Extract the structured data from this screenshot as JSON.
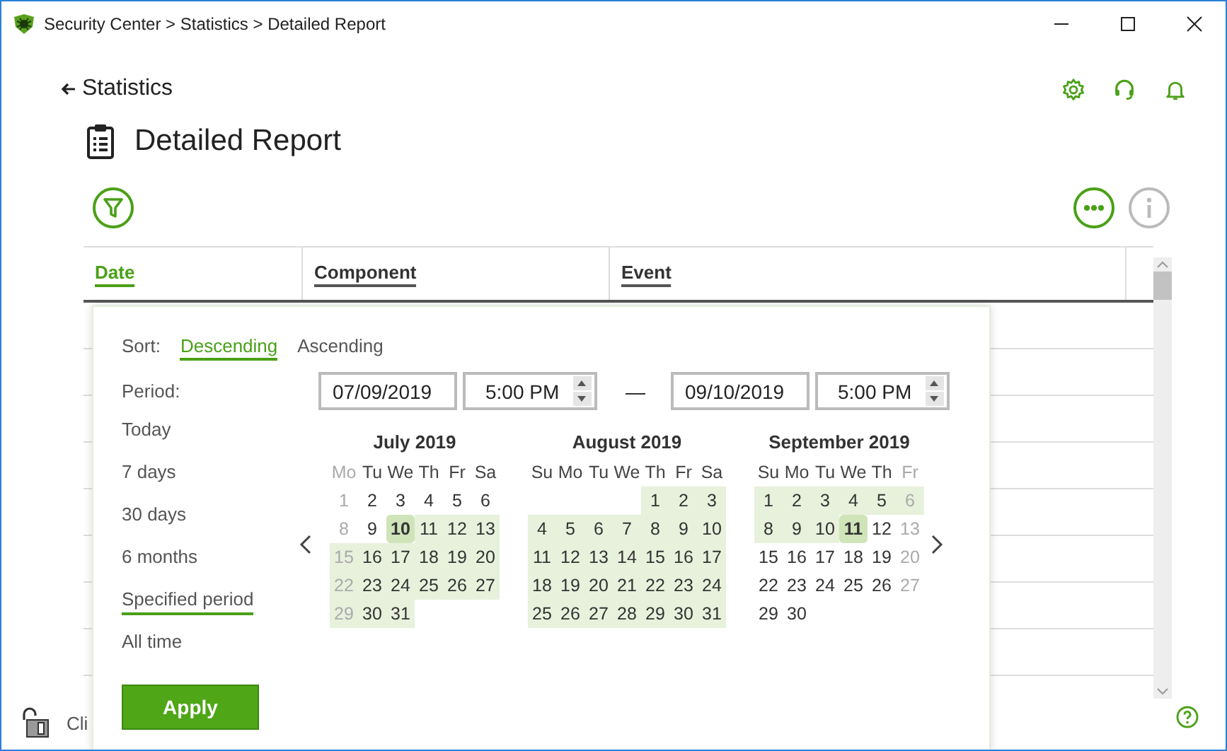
{
  "window": {
    "title": "Security Center > Statistics > Detailed Report"
  },
  "back_link": "Statistics",
  "page_title": "Detailed Report",
  "table": {
    "columns": [
      {
        "label": "Date",
        "selected": true
      },
      {
        "label": "Component",
        "selected": false
      },
      {
        "label": "Event",
        "selected": false
      }
    ]
  },
  "filter_panel": {
    "sort_label": "Sort:",
    "sort_options": [
      {
        "label": "Descending",
        "selected": true
      },
      {
        "label": "Ascending",
        "selected": false
      }
    ],
    "period_label": "Period:",
    "periods": [
      {
        "label": "Today",
        "selected": false
      },
      {
        "label": "7 days",
        "selected": false
      },
      {
        "label": "30 days",
        "selected": false
      },
      {
        "label": "6 months",
        "selected": false
      },
      {
        "label": "Specified period",
        "selected": true
      },
      {
        "label": "All time",
        "selected": false
      }
    ],
    "from": {
      "date": "07/09/2019",
      "time": "5:00 PM"
    },
    "separator": "—",
    "to": {
      "date": "09/10/2019",
      "time": "5:00 PM"
    },
    "months": [
      {
        "title": "July 2019",
        "weekdays": [
          {
            "label": "Mo",
            "faded": true
          },
          {
            "label": "Tu",
            "faded": false
          },
          {
            "label": "We",
            "faded": false
          },
          {
            "label": "Th",
            "faded": false
          },
          {
            "label": "Fr",
            "faded": false
          },
          {
            "label": "Sa",
            "faded": false
          }
        ],
        "weeks": [
          [
            {
              "day": "1",
              "in_range": false,
              "selected": false,
              "faded": true
            },
            {
              "day": "2",
              "in_range": false,
              "selected": false,
              "faded": false
            },
            {
              "day": "3",
              "in_range": false,
              "selected": false,
              "faded": false
            },
            {
              "day": "4",
              "in_range": false,
              "selected": false,
              "faded": false
            },
            {
              "day": "5",
              "in_range": false,
              "selected": false,
              "faded": false
            },
            {
              "day": "6",
              "in_range": false,
              "selected": false,
              "faded": false
            }
          ],
          [
            {
              "day": "8",
              "in_range": false,
              "selected": false,
              "faded": true
            },
            {
              "day": "9",
              "in_range": false,
              "selected": false,
              "faded": false
            },
            {
              "day": "10",
              "in_range": true,
              "selected": true,
              "faded": false
            },
            {
              "day": "11",
              "in_range": true,
              "selected": false,
              "faded": false
            },
            {
              "day": "12",
              "in_range": true,
              "selected": false,
              "faded": false
            },
            {
              "day": "13",
              "in_range": true,
              "selected": false,
              "faded": false
            }
          ],
          [
            {
              "day": "15",
              "in_range": true,
              "selected": false,
              "faded": true
            },
            {
              "day": "16",
              "in_range": true,
              "selected": false,
              "faded": false
            },
            {
              "day": "17",
              "in_range": true,
              "selected": false,
              "faded": false
            },
            {
              "day": "18",
              "in_range": true,
              "selected": false,
              "faded": false
            },
            {
              "day": "19",
              "in_range": true,
              "selected": false,
              "faded": false
            },
            {
              "day": "20",
              "in_range": true,
              "selected": false,
              "faded": false
            }
          ],
          [
            {
              "day": "22",
              "in_range": true,
              "selected": false,
              "faded": true
            },
            {
              "day": "23",
              "in_range": true,
              "selected": false,
              "faded": false
            },
            {
              "day": "24",
              "in_range": true,
              "selected": false,
              "faded": false
            },
            {
              "day": "25",
              "in_range": true,
              "selected": false,
              "faded": false
            },
            {
              "day": "26",
              "in_range": true,
              "selected": false,
              "faded": false
            },
            {
              "day": "27",
              "in_range": true,
              "selected": false,
              "faded": false
            }
          ],
          [
            {
              "day": "29",
              "in_range": true,
              "selected": false,
              "faded": true
            },
            {
              "day": "30",
              "in_range": true,
              "selected": false,
              "faded": false
            },
            {
              "day": "31",
              "in_range": true,
              "selected": false,
              "faded": false
            }
          ]
        ]
      },
      {
        "title": "August 2019",
        "weekdays": [
          {
            "label": "Su",
            "faded": false
          },
          {
            "label": "Mo",
            "faded": false
          },
          {
            "label": "Tu",
            "faded": false
          },
          {
            "label": "We",
            "faded": false
          },
          {
            "label": "Th",
            "faded": false
          },
          {
            "label": "Fr",
            "faded": false
          },
          {
            "label": "Sa",
            "faded": false
          }
        ],
        "weeks": [
          [
            {
              "day": "1",
              "in_range": true,
              "selected": false,
              "faded": false
            },
            {
              "day": "2",
              "in_range": true,
              "selected": false,
              "faded": false
            },
            {
              "day": "3",
              "in_range": true,
              "selected": false,
              "faded": false
            }
          ],
          [
            {
              "day": "4",
              "in_range": true,
              "selected": false,
              "faded": false
            },
            {
              "day": "5",
              "in_range": true,
              "selected": false,
              "faded": false
            },
            {
              "day": "6",
              "in_range": true,
              "selected": false,
              "faded": false
            },
            {
              "day": "7",
              "in_range": true,
              "selected": false,
              "faded": false
            },
            {
              "day": "8",
              "in_range": true,
              "selected": false,
              "faded": false
            },
            {
              "day": "9",
              "in_range": true,
              "selected": false,
              "faded": false
            },
            {
              "day": "10",
              "in_range": true,
              "selected": false,
              "faded": false
            }
          ],
          [
            {
              "day": "11",
              "in_range": true,
              "selected": false,
              "faded": false
            },
            {
              "day": "12",
              "in_range": true,
              "selected": false,
              "faded": false
            },
            {
              "day": "13",
              "in_range": true,
              "selected": false,
              "faded": false
            },
            {
              "day": "14",
              "in_range": true,
              "selected": false,
              "faded": false
            },
            {
              "day": "15",
              "in_range": true,
              "selected": false,
              "faded": false
            },
            {
              "day": "16",
              "in_range": true,
              "selected": false,
              "faded": false
            },
            {
              "day": "17",
              "in_range": true,
              "selected": false,
              "faded": false
            }
          ],
          [
            {
              "day": "18",
              "in_range": true,
              "selected": false,
              "faded": false
            },
            {
              "day": "19",
              "in_range": true,
              "selected": false,
              "faded": false
            },
            {
              "day": "20",
              "in_range": true,
              "selected": false,
              "faded": false
            },
            {
              "day": "21",
              "in_range": true,
              "selected": false,
              "faded": false
            },
            {
              "day": "22",
              "in_range": true,
              "selected": false,
              "faded": false
            },
            {
              "day": "23",
              "in_range": true,
              "selected": false,
              "faded": false
            },
            {
              "day": "24",
              "in_range": true,
              "selected": false,
              "faded": false
            }
          ],
          [
            {
              "day": "25",
              "in_range": true,
              "selected": false,
              "faded": false
            },
            {
              "day": "26",
              "in_range": true,
              "selected": false,
              "faded": false
            },
            {
              "day": "27",
              "in_range": true,
              "selected": false,
              "faded": false
            },
            {
              "day": "28",
              "in_range": true,
              "selected": false,
              "faded": false
            },
            {
              "day": "29",
              "in_range": true,
              "selected": false,
              "faded": false
            },
            {
              "day": "30",
              "in_range": true,
              "selected": false,
              "faded": false
            },
            {
              "day": "31",
              "in_range": true,
              "selected": false,
              "faded": false
            }
          ]
        ]
      },
      {
        "title": "September 2019",
        "weekdays": [
          {
            "label": "Su",
            "faded": false
          },
          {
            "label": "Mo",
            "faded": false
          },
          {
            "label": "Tu",
            "faded": false
          },
          {
            "label": "We",
            "faded": false
          },
          {
            "label": "Th",
            "faded": false
          },
          {
            "label": "Fr",
            "faded": true
          }
        ],
        "weeks": [
          [
            {
              "day": "1",
              "in_range": true,
              "selected": false,
              "faded": false
            },
            {
              "day": "2",
              "in_range": true,
              "selected": false,
              "faded": false
            },
            {
              "day": "3",
              "in_range": true,
              "selected": false,
              "faded": false
            },
            {
              "day": "4",
              "in_range": true,
              "selected": false,
              "faded": false
            },
            {
              "day": "5",
              "in_range": true,
              "selected": false,
              "faded": false
            },
            {
              "day": "6",
              "in_range": true,
              "selected": false,
              "faded": true
            }
          ],
          [
            {
              "day": "8",
              "in_range": true,
              "selected": false,
              "faded": false
            },
            {
              "day": "9",
              "in_range": true,
              "selected": false,
              "faded": false
            },
            {
              "day": "10",
              "in_range": true,
              "selected": false,
              "faded": false
            },
            {
              "day": "11",
              "in_range": true,
              "selected": true,
              "faded": false
            },
            {
              "day": "12",
              "in_range": false,
              "selected": false,
              "faded": false
            },
            {
              "day": "13",
              "in_range": false,
              "selected": false,
              "faded": true
            }
          ],
          [
            {
              "day": "15",
              "in_range": false,
              "selected": false,
              "faded": false
            },
            {
              "day": "16",
              "in_range": false,
              "selected": false,
              "faded": false
            },
            {
              "day": "17",
              "in_range": false,
              "selected": false,
              "faded": false
            },
            {
              "day": "18",
              "in_range": false,
              "selected": false,
              "faded": false
            },
            {
              "day": "19",
              "in_range": false,
              "selected": false,
              "faded": false
            },
            {
              "day": "20",
              "in_range": false,
              "selected": false,
              "faded": true
            }
          ],
          [
            {
              "day": "22",
              "in_range": false,
              "selected": false,
              "faded": false
            },
            {
              "day": "23",
              "in_range": false,
              "selected": false,
              "faded": false
            },
            {
              "day": "24",
              "in_range": false,
              "selected": false,
              "faded": false
            },
            {
              "day": "25",
              "in_range": false,
              "selected": false,
              "faded": false
            },
            {
              "day": "26",
              "in_range": false,
              "selected": false,
              "faded": false
            },
            {
              "day": "27",
              "in_range": false,
              "selected": false,
              "faded": true
            }
          ],
          [
            {
              "day": "29",
              "in_range": false,
              "selected": false,
              "faded": false
            },
            {
              "day": "30",
              "in_range": false,
              "selected": false,
              "faded": false
            }
          ]
        ]
      }
    ],
    "apply": "Apply"
  },
  "status_bar": {
    "text": "Cli"
  }
}
